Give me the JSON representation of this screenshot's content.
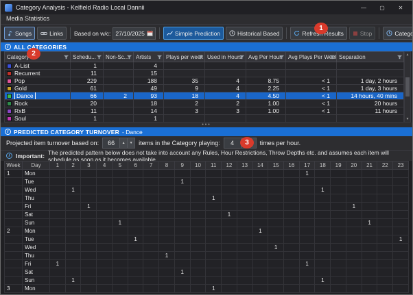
{
  "window": {
    "title": "Category Analysis - Kelfield Radio Local Dannii",
    "controls": {
      "minimize": "—",
      "maximize": "▢",
      "close": "✕"
    }
  },
  "menubar": {
    "label": "Media Statistics"
  },
  "toolbar": {
    "songs": "Songs",
    "links": "Links",
    "based_on_label": "Based on w/c:",
    "date_value": "27/10/2025",
    "simple_prediction": "Simple Prediction",
    "historical_based": "Historical Based",
    "refresh_results": "Refresh Results",
    "stop": "Stop",
    "category_history": "Category History"
  },
  "annotations": {
    "n1": "1",
    "n2": "2",
    "n3": "3"
  },
  "categories": {
    "header": "ALL CATEGORIES",
    "columns": [
      "Category",
      "Schedu...",
      "Non-Sc...",
      "Artists",
      "Plays per week",
      "Used in Hours",
      "Avg Per Hour",
      "Avg Plays Per Week",
      "Separation"
    ],
    "rows": [
      {
        "name": "A-List",
        "color": "#3a4fd8",
        "scheduled": "1",
        "non_scheduled": "",
        "artists": "4",
        "plays_per_week": "",
        "used_in_hours": "",
        "avg_per_hour": "",
        "avg_plays_per_week": "",
        "separation": ""
      },
      {
        "name": "Recurrent",
        "color": "#c03028",
        "scheduled": "11",
        "non_scheduled": "",
        "artists": "15",
        "plays_per_week": "",
        "used_in_hours": "",
        "avg_per_hour": "",
        "avg_plays_per_week": "",
        "separation": ""
      },
      {
        "name": "Pop",
        "color": "#e0559a",
        "scheduled": "229",
        "non_scheduled": "",
        "artists": "188",
        "plays_per_week": "35",
        "used_in_hours": "4",
        "avg_per_hour": "8.75",
        "avg_plays_per_week": "< 1",
        "separation": "1 day, 2 hours"
      },
      {
        "name": "Gold",
        "color": "#c9a227",
        "scheduled": "61",
        "non_scheduled": "",
        "artists": "49",
        "plays_per_week": "9",
        "used_in_hours": "4",
        "avg_per_hour": "2.25",
        "avg_plays_per_week": "< 1",
        "separation": "1 day, 3 hours"
      },
      {
        "name": "Dance",
        "color": "#3dbb4a",
        "selected": true,
        "scheduled": "66",
        "non_scheduled": "2",
        "artists": "93",
        "plays_per_week": "18",
        "used_in_hours": "4",
        "avg_per_hour": "4.50",
        "avg_plays_per_week": "< 1",
        "separation": "14 hours, 40 mins"
      },
      {
        "name": "Rock",
        "color": "#2e8b4a",
        "scheduled": "20",
        "non_scheduled": "",
        "artists": "18",
        "plays_per_week": "2",
        "used_in_hours": "2",
        "avg_per_hour": "1.00",
        "avg_plays_per_week": "< 1",
        "separation": "20 hours"
      },
      {
        "name": "RxB",
        "color": "#8a46c8",
        "scheduled": "11",
        "non_scheduled": "",
        "artists": "14",
        "plays_per_week": "3",
        "used_in_hours": "3",
        "avg_per_hour": "1.00",
        "avg_plays_per_week": "< 1",
        "separation": "11 hours"
      },
      {
        "name": "Soul",
        "color": "#c13ab0",
        "scheduled": "1",
        "non_scheduled": "",
        "artists": "1",
        "plays_per_week": "",
        "used_in_hours": "",
        "avg_per_hour": "",
        "avg_plays_per_week": "",
        "separation": ""
      }
    ],
    "splitter_dots": "•••",
    "scroll_up": "▲",
    "scroll_down": "▼"
  },
  "turnover": {
    "header_title": "PREDICTED CATEGORY TURNOVER",
    "header_suffix": " - Dance",
    "label_before": "Projected item turnover based on:",
    "items_value": "66",
    "label_middle": "items in the Category playing:",
    "times_value": "4",
    "label_after": "times per hour.",
    "spin_up": "▲",
    "spin_down": "▼",
    "note_bold": "Important:",
    "note_text": "The predicted pattern below does not take into account any Rules, Hour Restrictions, Throw Depths etc. and assumes each item will schedule as soon as it becomes available"
  },
  "grid": {
    "week_header": "Week",
    "day_header": "Day",
    "hours": [
      "1",
      "2",
      "3",
      "4",
      "5",
      "6",
      "7",
      "8",
      "9",
      "10",
      "11",
      "12",
      "13",
      "14",
      "15",
      "16",
      "17",
      "18",
      "19",
      "20",
      "21",
      "22",
      "23"
    ],
    "mark_glyph": "1",
    "rows": [
      {
        "week": "1",
        "day": "Mon",
        "marks": [
          17
        ]
      },
      {
        "week": "",
        "day": "Tue",
        "marks": [
          9
        ]
      },
      {
        "week": "",
        "day": "Wed",
        "marks": [
          2,
          18
        ]
      },
      {
        "week": "",
        "day": "Thu",
        "marks": [
          11
        ]
      },
      {
        "week": "",
        "day": "Fri",
        "marks": [
          3,
          20
        ]
      },
      {
        "week": "",
        "day": "Sat",
        "marks": [
          12
        ]
      },
      {
        "week": "",
        "day": "Sun",
        "marks": [
          5,
          21
        ]
      },
      {
        "week": "2",
        "day": "Mon",
        "marks": [
          14
        ]
      },
      {
        "week": "",
        "day": "Tue",
        "marks": [
          6,
          23
        ]
      },
      {
        "week": "",
        "day": "Wed",
        "marks": [
          15
        ]
      },
      {
        "week": "",
        "day": "Thu",
        "marks": [
          8
        ]
      },
      {
        "week": "",
        "day": "Fri",
        "marks": [
          1,
          17
        ]
      },
      {
        "week": "",
        "day": "Sat",
        "marks": [
          9
        ]
      },
      {
        "week": "",
        "day": "Sun",
        "marks": [
          2,
          18
        ]
      },
      {
        "week": "3",
        "day": "Mon",
        "marks": [
          11
        ]
      }
    ]
  }
}
